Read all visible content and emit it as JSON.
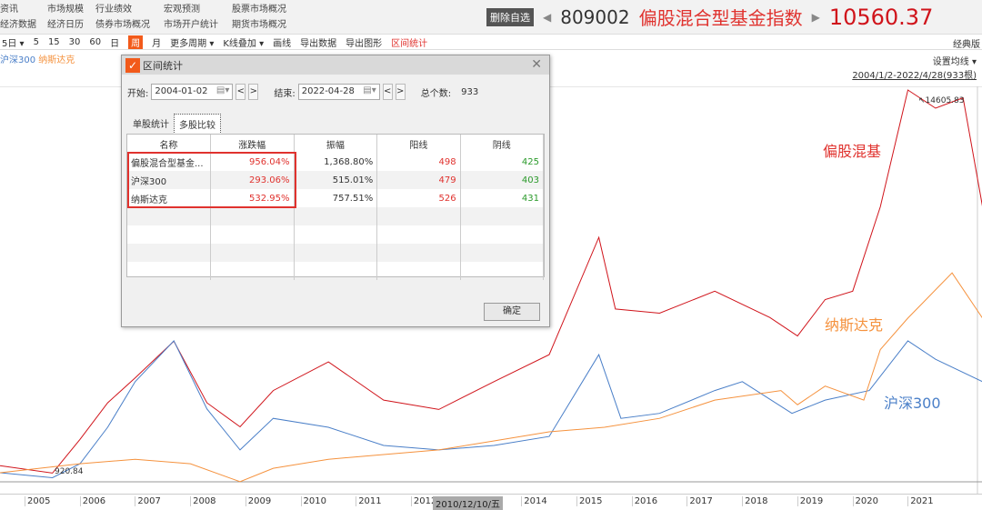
{
  "nav": {
    "row1": [
      "资讯",
      "市场规模",
      "行业绩效",
      "宏观预测",
      "股票市场概况"
    ],
    "row2": [
      "经济数据",
      "经济日历",
      "债券市场概况",
      "市场开户统计",
      "期货市场概况"
    ]
  },
  "header": {
    "delete_label": "删除自选",
    "code": "809002",
    "name": "偏股混合型基金指数",
    "price": "10560.37"
  },
  "toolbar": {
    "items": [
      "5日 ▾",
      "5",
      "15",
      "30",
      "60",
      "日",
      "周",
      "月",
      "更多周期 ▾",
      "K线叠加 ▾",
      "画线",
      "导出数据",
      "导出图形",
      "区间统计"
    ],
    "classic": "经典版"
  },
  "legend": {
    "hs300": "沪深300",
    "nasdaq": "纳斯达克"
  },
  "chart_info": {
    "set_ma": "设置均线 ▾",
    "range": "2004/1/2-2022/4/28(933根)",
    "peak_label": "↖14605.83",
    "start_label": "920.84"
  },
  "chart_data": {
    "type": "line",
    "ylim": [
      817,
      15000
    ],
    "yscale": "log",
    "xlim": [
      2004.55,
      2022.35
    ],
    "x_ticks": [
      "2005",
      "2006",
      "2007",
      "2008",
      "2009",
      "2010",
      "2011",
      "2012",
      "2014",
      "2015",
      "2016",
      "2017",
      "2018",
      "2019",
      "2020",
      "2021"
    ],
    "cursor_label": "2010/12/10/五",
    "series": [
      {
        "name": "偏股混基",
        "color": "#d0141b",
        "x": [
          2004.55,
          2005.5,
          2006,
          2006.5,
          2007,
          2007.7,
          2008.3,
          2008.9,
          2009.5,
          2010.5,
          2011.5,
          2012.5,
          2013.5,
          2014.5,
          2015.4,
          2015.7,
          2016.5,
          2017.5,
          2018.5,
          2019.0,
          2019.5,
          2020.0,
          2020.5,
          2021.0,
          2021.5,
          2022.0,
          2022.35
        ],
        "values": [
          950,
          900,
          1150,
          1500,
          1800,
          2350,
          1500,
          1260,
          1640,
          2020,
          1530,
          1430,
          1750,
          2130,
          5000,
          2970,
          2880,
          3380,
          2790,
          2440,
          3180,
          3380,
          6250,
          14606,
          12800,
          13800,
          6270
        ]
      },
      {
        "name": "沪深300",
        "color": "#4a7fc8",
        "x": [
          2004.55,
          2005.5,
          2006,
          2006.5,
          2007,
          2007.7,
          2008.3,
          2008.9,
          2009.5,
          2010.5,
          2011.5,
          2012.5,
          2013.5,
          2014.5,
          2015.4,
          2015.8,
          2016.5,
          2017.5,
          2018,
          2018.9,
          2019.5,
          2020.3,
          2021.0,
          2021.5,
          2022.35
        ],
        "values": [
          902,
          870,
          963,
          1256,
          1750,
          2355,
          1435,
          1065,
          1340,
          1256,
          1100,
          1065,
          1100,
          1175,
          2130,
          1340,
          1390,
          1640,
          1750,
          1390,
          1530,
          1640,
          2355,
          2060,
          1750
        ]
      },
      {
        "name": "纳斯达克",
        "color": "#f5923e",
        "x": [
          2004.55,
          2006,
          2007,
          2008,
          2008.9,
          2009.5,
          2010.5,
          2011.5,
          2012.5,
          2013.5,
          2014.5,
          2015.5,
          2016.5,
          2017.5,
          2018.7,
          2019.0,
          2019.5,
          2020.2,
          2020.5,
          2021.0,
          2021.8,
          2022.35
        ],
        "values": [
          902,
          963,
          995,
          963,
          845,
          932,
          995,
          1030,
          1065,
          1137,
          1215,
          1256,
          1340,
          1530,
          1640,
          1480,
          1695,
          1530,
          2210,
          2780,
          3860,
          2780
        ]
      }
    ]
  },
  "dialog": {
    "title": "区间统计",
    "start_label": "开始:",
    "start": "2004-01-02",
    "end_label": "结束:",
    "end": "2022-04-28",
    "total_label": "总个数:",
    "total": "933",
    "tabs": [
      "单股统计",
      "多股比较"
    ],
    "columns": [
      "名称",
      "涨跌幅",
      "振幅",
      "阳线",
      "阴线"
    ],
    "rows": [
      [
        "偏股混合型基金...",
        "956.04%",
        "1,368.80%",
        "498",
        "425"
      ],
      [
        "沪深300",
        "293.06%",
        "515.01%",
        "479",
        "403"
      ],
      [
        "纳斯达克",
        "532.95%",
        "757.51%",
        "526",
        "431"
      ]
    ],
    "ok": "确定"
  }
}
